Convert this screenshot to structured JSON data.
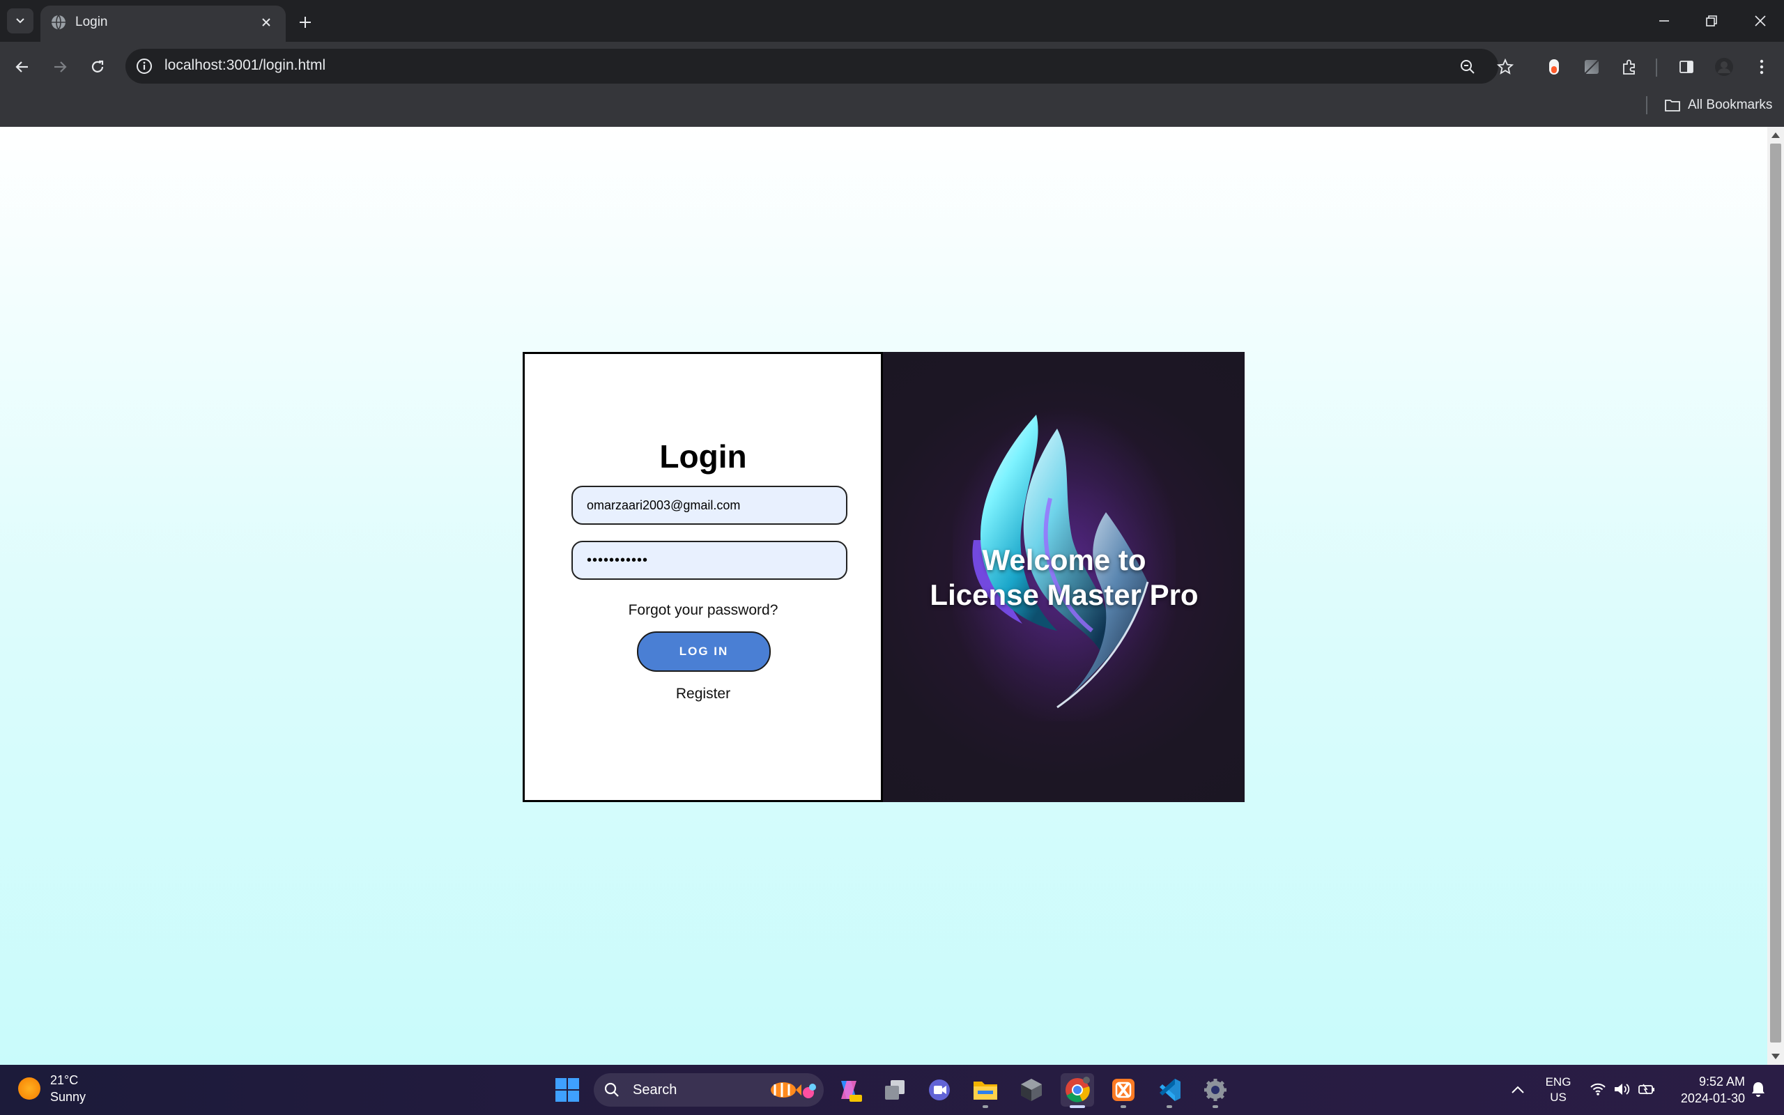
{
  "browser": {
    "tab": {
      "title": "Login"
    },
    "address": {
      "url": "localhost:3001/login.html"
    },
    "bookmarks": {
      "all_bookmarks_label": "All Bookmarks"
    }
  },
  "page": {
    "login": {
      "title": "Login",
      "email_value": "omarzaari2003@gmail.com",
      "password_value": "•••••••••••",
      "forgot_label": "Forgot your password?",
      "login_button_label": "LOG IN",
      "register_label": "Register"
    },
    "brand": {
      "welcome_line1": "Welcome to",
      "welcome_line2": "License Master Pro"
    }
  },
  "taskbar": {
    "weather": {
      "temp": "21°C",
      "condition": "Sunny"
    },
    "search_label": "Search",
    "tray": {
      "lang": "ENG",
      "region": "US",
      "time": "9:52 AM",
      "date": "2024-01-30"
    },
    "apps": [
      "windows-start",
      "copilot",
      "task-view",
      "teams-chat",
      "file-explorer",
      "unity-hub",
      "chrome",
      "xampp",
      "vscode",
      "settings"
    ]
  },
  "colors": {
    "tab_bar": "#202124",
    "toolbar": "#35363a",
    "login_button": "#4a7fd4",
    "brand_panel": "#1c1624",
    "input_bg": "#e8f0fe",
    "page_gradient_end": "#c9fbfb"
  }
}
